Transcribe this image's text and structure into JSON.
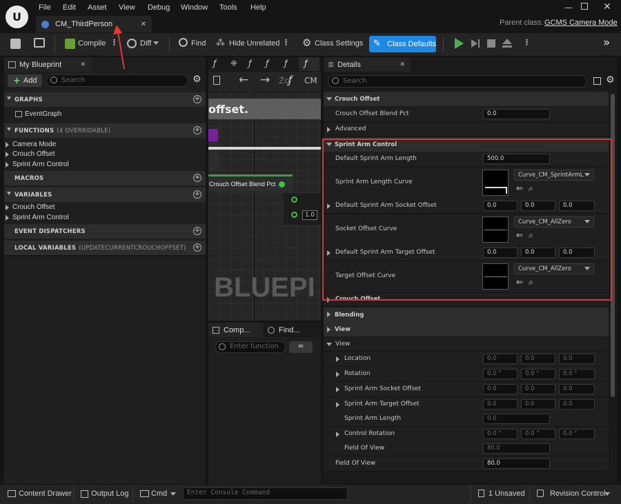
{
  "menu": [
    "File",
    "Edit",
    "Asset",
    "View",
    "Debug",
    "Window",
    "Tools",
    "Help"
  ],
  "doc_tab": "CM_ThirdPerson",
  "parent_class_label": "Parent class:",
  "parent_class_value": "GCMS Camera Mode",
  "toolbar": {
    "compile": "Compile",
    "diff": "Diff",
    "find": "Find",
    "hide_unrelated": "Hide Unrelated",
    "class_settings": "Class Settings",
    "class_defaults": "Class Defaults"
  },
  "my_blueprint": {
    "tab": "My Blueprint",
    "add": "Add",
    "search_placeholder": "Search",
    "graphs": "GRAPHS",
    "event_graph": "EventGraph",
    "functions": "FUNCTIONS",
    "functions_count": "(4 OVERRIDABLE)",
    "function_items": [
      "Camera Mode",
      "Crouch Offset",
      "Sprint Arm Control"
    ],
    "macros": "MACROS",
    "variables": "VARIABLES",
    "variable_items": [
      "Crouch Offset",
      "Sprint Arm Control"
    ],
    "event_dispatchers": "EVENT DISPATCHERS",
    "local_variables": "LOCAL VARIABLES",
    "local_variables_sub": "(UPDATECURRENTCROUCHOFFSET)"
  },
  "graph": {
    "title_fragment": "offset.",
    "node_label": "Crouch Offset Blend Pct",
    "pin_value": "1.0",
    "watermark": "BLUEPI",
    "zoom_fragment": "Zo",
    "cm_fragment": "CM"
  },
  "comp_tabs": {
    "comp": "Comp...",
    "find": "Find...",
    "search_placeholder": "Enter function"
  },
  "details": {
    "tab": "Details",
    "search_placeholder": "Search",
    "crouch_offset": "Crouch Offset",
    "crouch_blend_label": "Crouch Offset Blend Pct",
    "crouch_blend_value": "0.0",
    "advanced": "Advanced",
    "sprint_arm_control": "Sprint Arm Control",
    "default_sprint_len_label": "Default Sprint Arm Length",
    "default_sprint_len_value": "500.0",
    "sprint_len_curve_label": "Sprint Arm Length Curve",
    "sprint_len_curve_value": "Curve_CM_SprintArmL",
    "socket_offset_label": "Default Sprint Arm Socket Offset",
    "socket_offset_values": [
      "0.0",
      "0.0",
      "0.0"
    ],
    "socket_curve_label": "Socket Offset Curve",
    "socket_curve_value": "Curve_CM_AllZero",
    "target_offset_label": "Default Sprint Arm Target Offset",
    "target_offset_values": [
      "0.0",
      "0.0",
      "0.0"
    ],
    "target_curve_label": "Target Offset Curve",
    "target_curve_value": "Curve_CM_AllZero",
    "crouch_offset_collapsed": "Crouch Offset",
    "blending": "Blending",
    "view": "View",
    "view_sub": "View",
    "location_label": "Location",
    "location_values": [
      "0.0",
      "0.0",
      "0.0"
    ],
    "rotation_label": "Rotation",
    "rotation_values": [
      "0.0 °",
      "0.0 °",
      "0.0 °"
    ],
    "sas_offset_label": "Sprint Arm Socket Offset",
    "sas_offset_values": [
      "0.0",
      "0.0",
      "0.0"
    ],
    "sat_offset_label": "Sprint Arm Target Offset",
    "sat_offset_values": [
      "0.0",
      "0.0",
      "0.0"
    ],
    "sal_label": "Sprint Arm Length",
    "sal_value": "0.0",
    "control_rotation_label": "Control Rotation",
    "control_rotation_values": [
      "0.0 °",
      "0.0 °",
      "0.0 °"
    ],
    "fov_inner_label": "Field Of View",
    "fov_inner_value": "80.0",
    "fov_label": "Field Of View",
    "fov_value": "80.0"
  },
  "status": {
    "content_drawer": "Content Drawer",
    "output_log": "Output Log",
    "cmd": "Cmd",
    "console_placeholder": "Enter Console Command",
    "unsaved": "1 Unsaved",
    "revision": "Revision Control"
  },
  "colors": {
    "accent": "#1e88e5",
    "highlight_box": "#d9383a",
    "annotation_arrow": "#e53935",
    "play_green": "#4caf50"
  }
}
